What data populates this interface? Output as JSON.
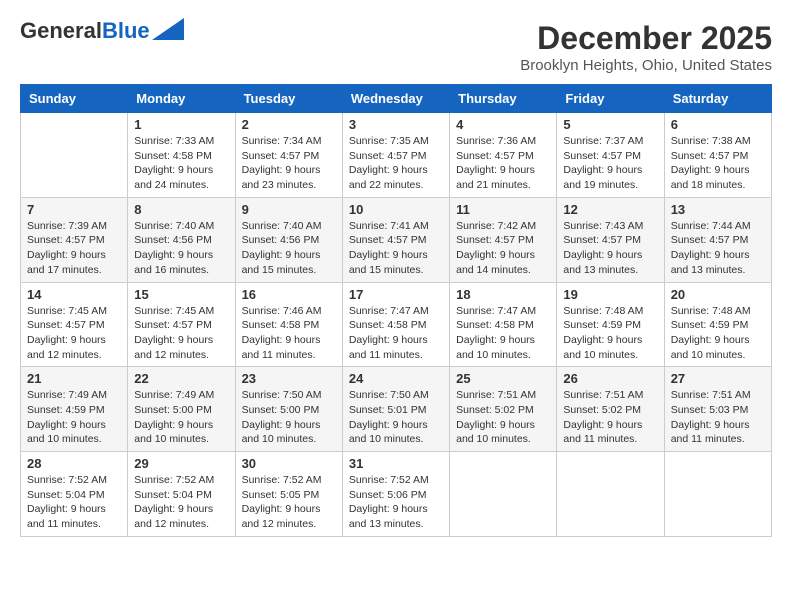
{
  "header": {
    "logo_general": "General",
    "logo_blue": "Blue",
    "month": "December 2025",
    "location": "Brooklyn Heights, Ohio, United States"
  },
  "weekdays": [
    "Sunday",
    "Monday",
    "Tuesday",
    "Wednesday",
    "Thursday",
    "Friday",
    "Saturday"
  ],
  "weeks": [
    [
      {
        "day": "",
        "info": ""
      },
      {
        "day": "1",
        "info": "Sunrise: 7:33 AM\nSunset: 4:58 PM\nDaylight: 9 hours\nand 24 minutes."
      },
      {
        "day": "2",
        "info": "Sunrise: 7:34 AM\nSunset: 4:57 PM\nDaylight: 9 hours\nand 23 minutes."
      },
      {
        "day": "3",
        "info": "Sunrise: 7:35 AM\nSunset: 4:57 PM\nDaylight: 9 hours\nand 22 minutes."
      },
      {
        "day": "4",
        "info": "Sunrise: 7:36 AM\nSunset: 4:57 PM\nDaylight: 9 hours\nand 21 minutes."
      },
      {
        "day": "5",
        "info": "Sunrise: 7:37 AM\nSunset: 4:57 PM\nDaylight: 9 hours\nand 19 minutes."
      },
      {
        "day": "6",
        "info": "Sunrise: 7:38 AM\nSunset: 4:57 PM\nDaylight: 9 hours\nand 18 minutes."
      }
    ],
    [
      {
        "day": "7",
        "info": "Sunrise: 7:39 AM\nSunset: 4:57 PM\nDaylight: 9 hours\nand 17 minutes."
      },
      {
        "day": "8",
        "info": "Sunrise: 7:40 AM\nSunset: 4:56 PM\nDaylight: 9 hours\nand 16 minutes."
      },
      {
        "day": "9",
        "info": "Sunrise: 7:40 AM\nSunset: 4:56 PM\nDaylight: 9 hours\nand 15 minutes."
      },
      {
        "day": "10",
        "info": "Sunrise: 7:41 AM\nSunset: 4:57 PM\nDaylight: 9 hours\nand 15 minutes."
      },
      {
        "day": "11",
        "info": "Sunrise: 7:42 AM\nSunset: 4:57 PM\nDaylight: 9 hours\nand 14 minutes."
      },
      {
        "day": "12",
        "info": "Sunrise: 7:43 AM\nSunset: 4:57 PM\nDaylight: 9 hours\nand 13 minutes."
      },
      {
        "day": "13",
        "info": "Sunrise: 7:44 AM\nSunset: 4:57 PM\nDaylight: 9 hours\nand 13 minutes."
      }
    ],
    [
      {
        "day": "14",
        "info": "Sunrise: 7:45 AM\nSunset: 4:57 PM\nDaylight: 9 hours\nand 12 minutes."
      },
      {
        "day": "15",
        "info": "Sunrise: 7:45 AM\nSunset: 4:57 PM\nDaylight: 9 hours\nand 12 minutes."
      },
      {
        "day": "16",
        "info": "Sunrise: 7:46 AM\nSunset: 4:58 PM\nDaylight: 9 hours\nand 11 minutes."
      },
      {
        "day": "17",
        "info": "Sunrise: 7:47 AM\nSunset: 4:58 PM\nDaylight: 9 hours\nand 11 minutes."
      },
      {
        "day": "18",
        "info": "Sunrise: 7:47 AM\nSunset: 4:58 PM\nDaylight: 9 hours\nand 10 minutes."
      },
      {
        "day": "19",
        "info": "Sunrise: 7:48 AM\nSunset: 4:59 PM\nDaylight: 9 hours\nand 10 minutes."
      },
      {
        "day": "20",
        "info": "Sunrise: 7:48 AM\nSunset: 4:59 PM\nDaylight: 9 hours\nand 10 minutes."
      }
    ],
    [
      {
        "day": "21",
        "info": "Sunrise: 7:49 AM\nSunset: 4:59 PM\nDaylight: 9 hours\nand 10 minutes."
      },
      {
        "day": "22",
        "info": "Sunrise: 7:49 AM\nSunset: 5:00 PM\nDaylight: 9 hours\nand 10 minutes."
      },
      {
        "day": "23",
        "info": "Sunrise: 7:50 AM\nSunset: 5:00 PM\nDaylight: 9 hours\nand 10 minutes."
      },
      {
        "day": "24",
        "info": "Sunrise: 7:50 AM\nSunset: 5:01 PM\nDaylight: 9 hours\nand 10 minutes."
      },
      {
        "day": "25",
        "info": "Sunrise: 7:51 AM\nSunset: 5:02 PM\nDaylight: 9 hours\nand 10 minutes."
      },
      {
        "day": "26",
        "info": "Sunrise: 7:51 AM\nSunset: 5:02 PM\nDaylight: 9 hours\nand 11 minutes."
      },
      {
        "day": "27",
        "info": "Sunrise: 7:51 AM\nSunset: 5:03 PM\nDaylight: 9 hours\nand 11 minutes."
      }
    ],
    [
      {
        "day": "28",
        "info": "Sunrise: 7:52 AM\nSunset: 5:04 PM\nDaylight: 9 hours\nand 11 minutes."
      },
      {
        "day": "29",
        "info": "Sunrise: 7:52 AM\nSunset: 5:04 PM\nDaylight: 9 hours\nand 12 minutes."
      },
      {
        "day": "30",
        "info": "Sunrise: 7:52 AM\nSunset: 5:05 PM\nDaylight: 9 hours\nand 12 minutes."
      },
      {
        "day": "31",
        "info": "Sunrise: 7:52 AM\nSunset: 5:06 PM\nDaylight: 9 hours\nand 13 minutes."
      },
      {
        "day": "",
        "info": ""
      },
      {
        "day": "",
        "info": ""
      },
      {
        "day": "",
        "info": ""
      }
    ]
  ]
}
